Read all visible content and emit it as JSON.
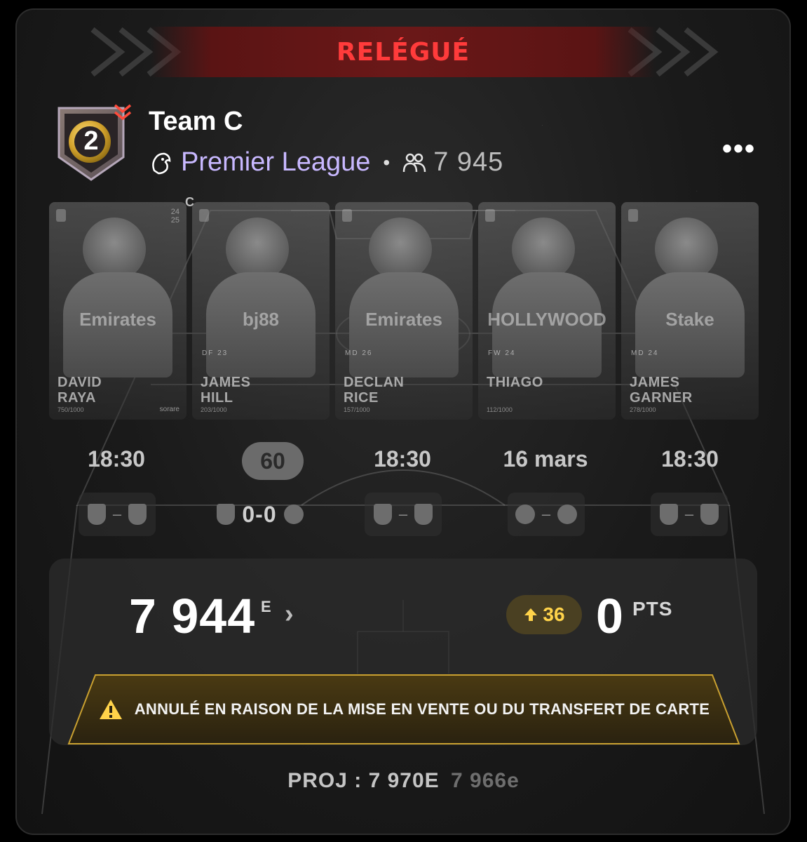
{
  "banner": {
    "label": "RELÉGUÉ"
  },
  "team": {
    "division_number": "2",
    "name": "Team C",
    "league": "Premier League",
    "separator": "•",
    "members": "7 945",
    "more_label": "•••"
  },
  "captain_marker": "C",
  "cards": [
    {
      "name": "DAVID\nRAYA",
      "position": "",
      "number": "24\n25",
      "rating": "750/1000",
      "sponsor": "Emirates",
      "brand": "sorare",
      "captain": false
    },
    {
      "name": "JAMES\nHILL",
      "position": "DF  23",
      "number": "",
      "rating": "203/1000",
      "sponsor": "bj88",
      "brand": "",
      "captain": true
    },
    {
      "name": "DECLAN\nRICE",
      "position": "MD  26",
      "number": "",
      "rating": "157/1000",
      "sponsor": "Emirates",
      "brand": "",
      "captain": false
    },
    {
      "name": "THIAGO",
      "position": "FW  24",
      "number": "",
      "rating": "112/1000",
      "sponsor": "HOLLYWOOD",
      "brand": "",
      "captain": false
    },
    {
      "name": "JAMES\nGARNER",
      "position": "MD  24",
      "number": "",
      "rating": "278/1000",
      "sponsor": "Stake",
      "brand": "",
      "captain": false
    }
  ],
  "fixtures": [
    {
      "time": "18:30",
      "live": false,
      "home_crest": "arsenal-crest-icon",
      "away_crest": "everton-crest-icon",
      "score": "–"
    },
    {
      "time": "60",
      "live": true,
      "home_crest": "burnley-crest-icon",
      "away_crest": "bournemouth-crest-icon",
      "score": "0-0"
    },
    {
      "time": "18:30",
      "live": false,
      "home_crest": "arsenal-crest-icon",
      "away_crest": "everton-crest-icon",
      "score": "–"
    },
    {
      "time": "16 mars",
      "live": false,
      "home_crest": "brentford-crest-icon",
      "away_crest": "wolves-crest-icon",
      "score": "–"
    },
    {
      "time": "18:30",
      "live": false,
      "home_crest": "arsenal-crest-icon",
      "away_crest": "everton-crest-icon",
      "score": "–"
    }
  ],
  "summary": {
    "rank": "7 944",
    "rank_suffix": "E",
    "rank_change": "36",
    "points": "0",
    "points_label": "PTS"
  },
  "warning": {
    "text": "ANNULÉ EN RAISON DE LA MISE EN VENTE OU DU TRANSFERT DE CARTE"
  },
  "projection": {
    "label": "PROJ : 7 970E",
    "previous": "7 966e"
  },
  "colors": {
    "banner_text": "#ff3b3b",
    "league_text": "#c8b8ff",
    "rank_up": "#ffd34a",
    "warning_border": "#c9a030"
  }
}
